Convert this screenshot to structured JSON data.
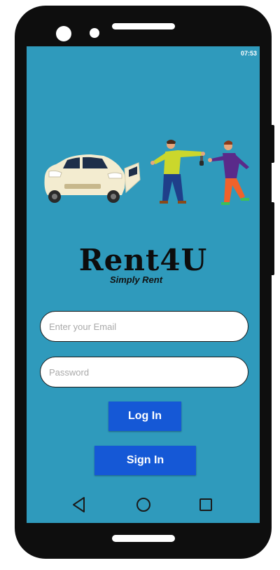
{
  "status_bar": {
    "time": "07:53"
  },
  "brand": {
    "name": "Rent4U",
    "tagline": "Simply Rent"
  },
  "form": {
    "email_placeholder": "Enter your Email",
    "email_value": "",
    "password_placeholder": "Password",
    "password_value": ""
  },
  "actions": {
    "login_label": "Log In",
    "signin_label": "Sign In"
  },
  "nav_bar": {
    "back_icon": "back-triangle-icon",
    "home_icon": "home-circle-icon",
    "recents_icon": "recents-square-icon"
  },
  "colors": {
    "screen_bg": "#2f9abc",
    "button": "#1558d6",
    "frame": "#0e0e0e"
  }
}
